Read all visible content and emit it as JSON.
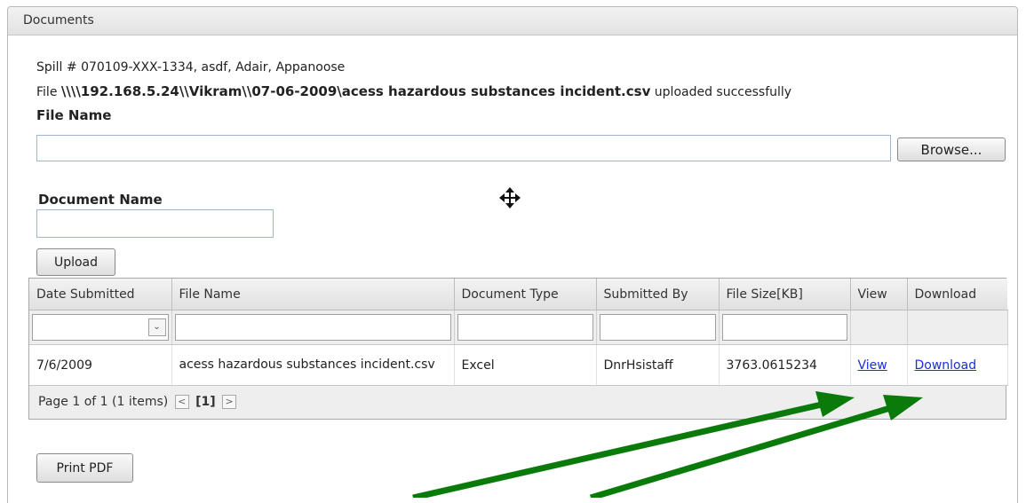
{
  "panel": {
    "title": "Documents"
  },
  "spill_info": "Spill # 070109-XXX-1334, asdf, Adair, Appanoose",
  "upload_status": {
    "prefix": "File ",
    "path": "\\\\\\\\192.168.5.24\\\\Vikram\\\\07-06-2009\\acess hazardous substances incident.csv",
    "suffix": " uploaded successfully"
  },
  "file_name_label": "File Name",
  "browse_label": "Browse...",
  "document_name_label": "Document Name",
  "upload_label": "Upload",
  "print_label": "Print PDF",
  "grid": {
    "columns": [
      "Date Submitted",
      "File Name",
      "Document Type",
      "Submitted By",
      "File Size[KB]",
      "View",
      "Download"
    ],
    "rows": [
      {
        "date": "7/6/2009",
        "file_name": "acess hazardous substances incident.csv",
        "doc_type": "Excel",
        "submitted_by": "DnrHsistaff",
        "file_size": "3763.0615234",
        "view": "View",
        "download": "Download"
      }
    ],
    "pager": {
      "summary": "Page 1 of 1 (1 items)",
      "current": "[1]"
    }
  },
  "icons": {
    "move": "move-cursor-icon",
    "arrow": "green-arrow-annotation"
  },
  "colors": {
    "link": "#1a2fd8",
    "arrow": "#0a7a0a"
  }
}
